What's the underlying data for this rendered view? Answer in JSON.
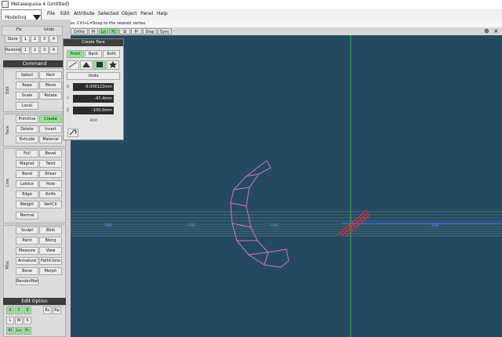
{
  "window": {
    "title": "Metasequoia 4 (Untitled)"
  },
  "menu": [
    "File",
    "Edit",
    "Attribute",
    "Selected",
    "Object",
    "Panel",
    "Help"
  ],
  "mode_select": {
    "value": "Modeling"
  },
  "hint": "L=Add a vertex.  Ctrl+L=Snap to the nearest vertex.",
  "undo_redo": {
    "undo": "Undo",
    "redo": "Fix"
  },
  "store": {
    "label": "Store",
    "slots": [
      "1",
      "2",
      "3",
      "4"
    ]
  },
  "restore": {
    "label": "Restore",
    "slots": [
      "1",
      "2",
      "3",
      "4"
    ]
  },
  "command": {
    "header": "Command",
    "edit_label": "Edit",
    "edit": [
      "Select",
      "Rect",
      "Rope",
      "Move",
      "Scale",
      "Rotate",
      "Local"
    ],
    "face_label": "Face",
    "face": [
      "Primitive",
      "Create",
      "Delete",
      "Invert",
      "Extrude",
      "Material"
    ],
    "line_label": "Line",
    "line": [
      "Pull",
      "Bevel",
      "Magnet",
      "Twist",
      "Bend",
      "Shear",
      "Lattice",
      "Hole",
      "Edge",
      "Knife",
      "Weight",
      "VertClr",
      "Normal"
    ],
    "misc_label": "Misc",
    "misc": [
      "Sculpt",
      "Blob",
      "Paint",
      "Bking",
      "Measure",
      "View",
      "Armature",
      "PathClone",
      "Bone",
      "Morph",
      "RenderMan"
    ]
  },
  "edit_option": {
    "header": "Edit Option",
    "row1": [
      "X",
      "Y",
      "Z"
    ],
    "row1_right": [
      "Rc",
      "Rp"
    ],
    "row2": [
      "L",
      "W",
      "S"
    ],
    "row3": [
      "Pt",
      "Ln",
      "Fc"
    ]
  },
  "view_toolbar": [
    "Ortho",
    "Pt",
    "Ln",
    "Fc",
    "Sl",
    "Fr",
    "Disp",
    "Sync"
  ],
  "create_face": {
    "title": "Create Face",
    "tabs": [
      "Front",
      "Back",
      "Both"
    ],
    "undo": "Undo",
    "x_label": "X",
    "x_value": "-0.000122mm",
    "y_label": "Y",
    "y_value": "-47.4mm",
    "z_label": "Z",
    "z_value": "-100.0mm",
    "add": "Add"
  },
  "grid_labels": [
    "-300",
    "-200",
    "-100",
    "100"
  ],
  "colors": {
    "viewport_bg": "#234a60",
    "active_button": "#92e692",
    "model_edges": "#e070c0",
    "x_axis": "#3a6cff",
    "y_axis": "#3bd23b",
    "grid": "#8fa6b2",
    "highlight": "#ff2030"
  }
}
